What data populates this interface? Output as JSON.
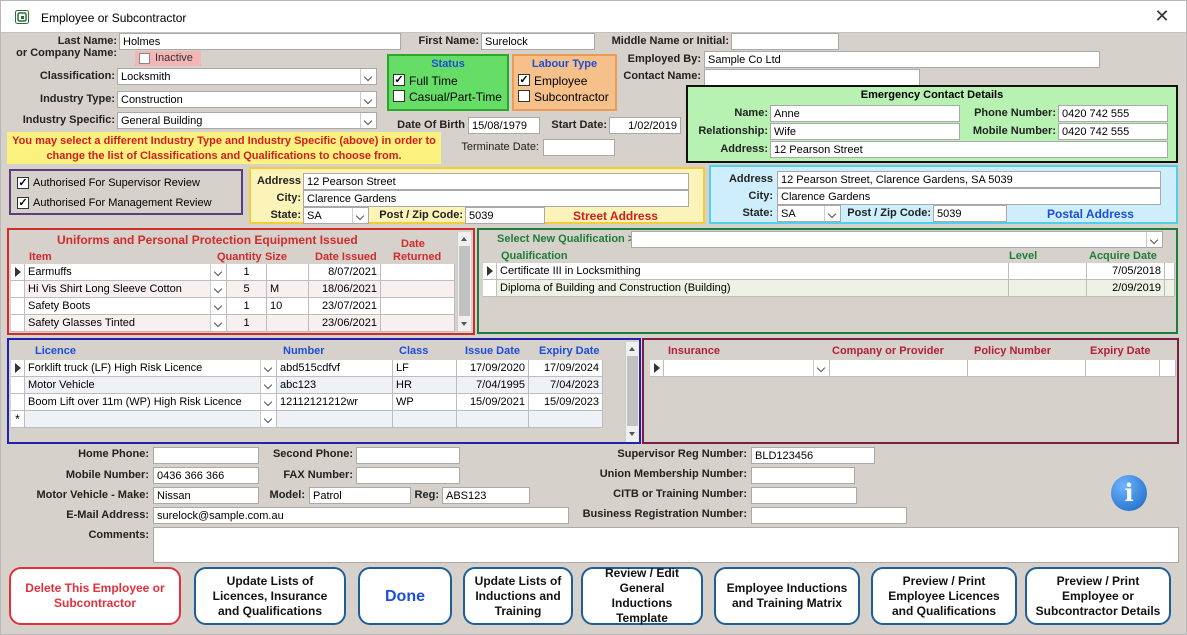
{
  "window": {
    "title": "Employee or Subcontractor",
    "close_glyph": "✕"
  },
  "top": {
    "last_name_label": "Last Name:",
    "company_name_label": "or Company Name:",
    "last_name": "Holmes",
    "inactive_label": "Inactive",
    "first_name_label": "First Name:",
    "first_name": "Surelock",
    "middle_name_label": "Middle Name or Initial:",
    "middle_name": "",
    "employed_by_label": "Employed By:",
    "employed_by": "Sample Co Ltd",
    "contact_name_label": "Contact Name:",
    "contact_name": "",
    "classification_label": "Classification:",
    "classification": "Locksmith",
    "industry_type_label": "Industry Type:",
    "industry_type": "Construction",
    "industry_specific_label": "Industry Specific:",
    "industry_specific": "General Building",
    "hint": "You may select a different Industry Type and Industry Specific (above) in order to change the list of Classifications and Qualifications to choose from.",
    "dob_label": "Date Of Birth",
    "dob": "15/08/1979",
    "start_label": "Start Date:",
    "start_date": "1/02/2019",
    "terminate_label": "Terminate Date:",
    "terminate_date": ""
  },
  "status": {
    "title": "Status",
    "full_time": "Full Time",
    "casual": "Casual/Part-Time",
    "color": "#66dd66"
  },
  "labour": {
    "title": "Labour Type",
    "employee": "Employee",
    "subcontractor": "Subcontractor",
    "color": "#f5c08a"
  },
  "emergency": {
    "title": "Emergency Contact Details",
    "name_label": "Name:",
    "name": "Anne",
    "relationship_label": "Relationship:",
    "relationship": "Wife",
    "address_label": "Address:",
    "address": "12 Pearson Street",
    "phone_label": "Phone Number:",
    "phone": "0420 742 555",
    "mobile_label": "Mobile Number:",
    "mobile": "0420 742 555",
    "color": "#b7f2b3"
  },
  "review": {
    "supervisor": "Authorised For Supervisor Review",
    "management": "Authorised For Management Review"
  },
  "street": {
    "address_label": "Address",
    "address": "12 Pearson Street",
    "city_label": "City:",
    "city": "Clarence Gardens",
    "state_label": "State:",
    "state": "SA",
    "zip_label": "Post / Zip Code:",
    "zip": "5039",
    "caption": "Street Address",
    "color": "#fbf3b8"
  },
  "postal": {
    "address_label": "Address",
    "address": "12 Pearson Street, Clarence Gardens, SA 5039",
    "city_label": "City:",
    "city": "Clarence Gardens",
    "state_label": "State:",
    "state": "SA",
    "zip_label": "Post / Zip Code:",
    "zip": "5039",
    "caption": "Postal Address",
    "color": "#cdeefa"
  },
  "ppe": {
    "title": "Uniforms and Personal Protection Equipment Issued",
    "headers": {
      "item": "Item",
      "quantity": "Quantity",
      "size": "Size",
      "date_issued": "Date Issued",
      "date_returned_1": "Date",
      "date_returned_2": "Returned"
    },
    "rows": [
      {
        "item": "Earmuffs",
        "qty": "1",
        "size": "",
        "issued": "8/07/2021",
        "returned": ""
      },
      {
        "item": "Hi Vis Shirt Long Sleeve Cotton",
        "qty": "5",
        "size": "M",
        "issued": "18/06/2021",
        "returned": ""
      },
      {
        "item": "Safety Boots",
        "qty": "1",
        "size": "10",
        "issued": "23/07/2021",
        "returned": ""
      },
      {
        "item": "Safety Glasses Tinted",
        "qty": "1",
        "size": "",
        "issued": "23/06/2021",
        "returned": ""
      }
    ]
  },
  "qualifications": {
    "select_label": "Select New Qualification >",
    "headers": {
      "qualification": "Qualification",
      "level": "Level",
      "acquire": "Acquire Date"
    },
    "rows": [
      {
        "name": "Certificate III in Locksmithing",
        "level": "",
        "date": "7/05/2018"
      },
      {
        "name": "Diploma of Building and Construction (Building)",
        "level": "",
        "date": "2/09/2019"
      }
    ]
  },
  "licences": {
    "headers": {
      "licence": "Licence",
      "number": "Number",
      "class": "Class",
      "issue": "Issue Date",
      "expiry": "Expiry Date"
    },
    "rows": [
      {
        "licence": "Forklift truck (LF) High Risk Licence",
        "number": "abd515cdfvf",
        "class": "LF",
        "issue": "17/09/2020",
        "expiry": "17/09/2024"
      },
      {
        "licence": "Motor Vehicle",
        "number": "abc123",
        "class": "HR",
        "issue": "7/04/1995",
        "expiry": "7/04/2023"
      },
      {
        "licence": "Boom Lift over 11m (WP) High Risk Licence",
        "number": "12112121212wr",
        "class": "WP",
        "issue": "15/09/2021",
        "expiry": "15/09/2023"
      }
    ],
    "new_row_marker": "*"
  },
  "insurance": {
    "headers": {
      "insurance": "Insurance",
      "company": "Company or Provider",
      "policy": "Policy Number",
      "expiry": "Expiry Date"
    }
  },
  "contact": {
    "home_label": "Home Phone:",
    "home": "",
    "mobile_label": "Mobile Number:",
    "mobile": "0436 366 366",
    "vehicle_label": "Motor Vehicle - Make:",
    "vehicle": "Nissan",
    "email_label": "E-Mail Address:",
    "email": "surelock@sample.com.au",
    "comments_label": "Comments:",
    "comments": "",
    "second_label": "Second Phone:",
    "second": "",
    "fax_label": "FAX Number:",
    "fax": "",
    "model_label": "Model:",
    "model": "Patrol",
    "reg_label": "Reg:",
    "reg": "ABS123",
    "supervisor_label": "Supervisor Reg Number:",
    "supervisor": "BLD123456",
    "union_label": "Union Membership Number:",
    "union": "",
    "citb_label": "CITB or Training Number:",
    "citb": "",
    "business_label": "Business Registration Number:",
    "business": ""
  },
  "buttons": {
    "delete": "Delete This Employee or Subcontractor",
    "update_licences": "Update Lists of Licences, Insurance and Qualifications",
    "done": "Done",
    "update_inductions": "Update Lists  of Inductions and Training",
    "review_general": "Review / Edit General Inductions Template",
    "matrix": "Employee Inductions and Training Matrix",
    "preview_licences": "Preview / Print Employee Licences and Qualifications",
    "preview_details": "Preview / Print Employee or Subcontractor Details"
  },
  "info_icon": "i"
}
